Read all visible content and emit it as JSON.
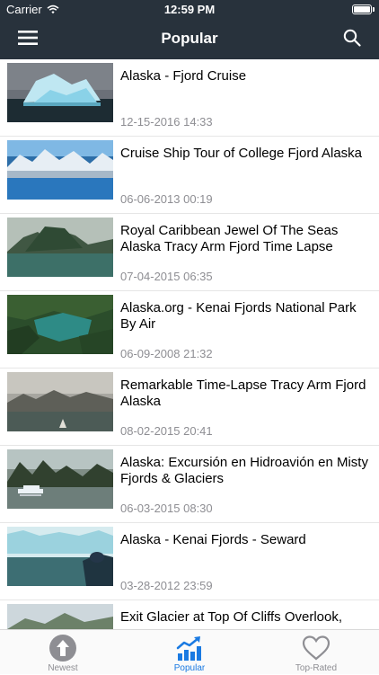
{
  "status_bar": {
    "carrier": "Carrier",
    "time": "12:59 PM"
  },
  "nav": {
    "title": "Popular",
    "menu_icon": "hamburger-icon",
    "search_icon": "search-icon"
  },
  "videos": [
    {
      "title": "Alaska - Fjord Cruise",
      "date": "12-15-2016 14:33",
      "thumb_scene": "iceberg"
    },
    {
      "title": "Cruise Ship Tour of College Fjord Alaska",
      "date": "06-06-2013 00:19",
      "thumb_scene": "glacier"
    },
    {
      "title": "Royal Caribbean Jewel Of The Seas Alaska Tracy Arm Fjord Time Lapse",
      "date": "07-04-2015 06:35",
      "thumb_scene": "green-fjord"
    },
    {
      "title": "Alaska.org - Kenai Fjords National Park By Air",
      "date": "06-09-2008 21:32",
      "thumb_scene": "aerial"
    },
    {
      "title": "Remarkable Time-Lapse Tracy Arm Fjord Alaska",
      "date": "08-02-2015 20:41",
      "thumb_scene": "mist"
    },
    {
      "title": "Alaska: Excursión en Hidroavión en Misty Fjords & Glaciers",
      "date": "06-03-2015 08:30",
      "thumb_scene": "seaplane"
    },
    {
      "title": "Alaska - Kenai Fjords - Seward",
      "date": "03-28-2012 23:59",
      "thumb_scene": "ice-wall"
    },
    {
      "title": "Exit Glacier at Top Of Cliffs Overlook,",
      "date": "",
      "thumb_scene": "mountain"
    }
  ],
  "tab_bar": {
    "tabs": [
      {
        "label": "Newest",
        "icon": "upload-arrow-icon",
        "active": false
      },
      {
        "label": "Popular",
        "icon": "trending-chart-icon",
        "active": true
      },
      {
        "label": "Top-Rated",
        "icon": "heart-icon",
        "active": false
      }
    ],
    "active_color": "#1a7ae2",
    "inactive_color": "#8e8e93"
  },
  "colors": {
    "nav_background": "#28323c",
    "date_text": "#8e8e93"
  }
}
